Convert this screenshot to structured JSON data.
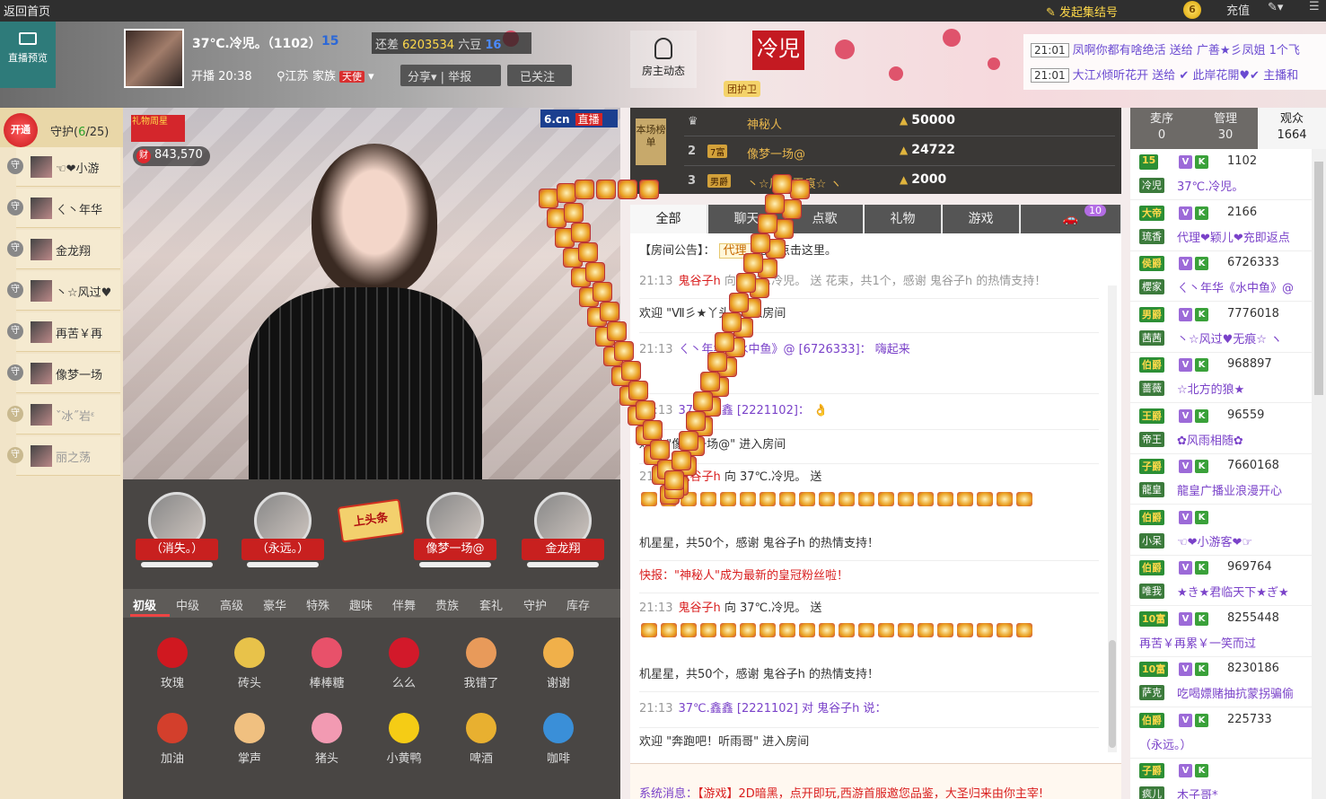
{
  "topbar": {
    "back_label": "返回首页",
    "rally_label": "发起集结号",
    "coin_label": "6",
    "recharge_label": "充值"
  },
  "header": {
    "preview_label": "直播预览",
    "host_name": "37℃.冷児。（1102）",
    "host_level": "15",
    "gap_label": "还差",
    "gap_amount": "6203534",
    "gap_unit": "六豆",
    "next_level": "16",
    "live_time": "开播 20:38",
    "location": "江苏",
    "family_label": "家族",
    "family_tag": "天使",
    "share_label": "分享▾ | 举报",
    "follow_label": "已关注",
    "owner_news_label": "房主动态",
    "room_logo": "冷児",
    "guard_badge": "团护卫",
    "ticker": [
      {
        "time": "21:01",
        "text": "凤啊你都有啥绝活 送给 广善★彡凤姐 1个飞"
      },
      {
        "time": "21:01",
        "text": "大江ﾒ倾听花开 送给 ✔ 此岸花開♥✔ 主播和"
      }
    ]
  },
  "guards": {
    "open_label": "开通",
    "title": "守护(",
    "count": "6",
    "total": "/25)",
    "g_label": "守",
    "items": [
      {
        "name": "☜❤小游"
      },
      {
        "name": "ㄑ丶年华"
      },
      {
        "name": "金龙翔"
      },
      {
        "name": "丶☆风过♥"
      },
      {
        "name": "再苦￥再"
      },
      {
        "name": "像梦一场"
      },
      {
        "name": "ˇ冰˝岩ᵋ"
      },
      {
        "name": "丽之荡"
      }
    ]
  },
  "video": {
    "gift_star": "礼物周星",
    "wealth_label": "财",
    "wealth_value": "843,570",
    "brand": "6.cn",
    "brand_tag": "直播"
  },
  "fans": [
    {
      "name": "（消失。）"
    },
    {
      "name": "（永远。）"
    },
    {
      "name": "像梦一场@"
    },
    {
      "name": "金龙翔"
    }
  ],
  "headline_label": "上头条",
  "gift_tabs": [
    "初级",
    "中级",
    "高级",
    "豪华",
    "特殊",
    "趣味",
    "伴舞",
    "贵族",
    "套礼",
    "守护",
    "库存"
  ],
  "gifts": [
    {
      "name": "玫瑰",
      "color": "#d01820"
    },
    {
      "name": "砖头",
      "color": "#e8c24a"
    },
    {
      "name": "棒棒糖",
      "color": "#e8516a"
    },
    {
      "name": "么么",
      "color": "#d2192a"
    },
    {
      "name": "我错了",
      "color": "#e89a5a"
    },
    {
      "name": "谢谢",
      "color": "#f0b04a"
    },
    {
      "name": "加油",
      "color": "#d33f2c"
    },
    {
      "name": "掌声",
      "color": "#f0c080"
    },
    {
      "name": "猪头",
      "color": "#f29ab2"
    },
    {
      "name": "小黄鸭",
      "color": "#f5cc15"
    },
    {
      "name": "啤酒",
      "color": "#e8b030"
    },
    {
      "name": "咖啡",
      "color": "#3a8fd8"
    }
  ],
  "rank": {
    "tag": "本场榜单",
    "rows": [
      {
        "no": "",
        "badge": "",
        "name": "神秘人",
        "value": "50000"
      },
      {
        "no": "2",
        "badge": "7富",
        "name": "像梦一场@",
        "value": "24722"
      },
      {
        "no": "3",
        "badge": "男爵",
        "name": "丶☆风过无痕☆ ヽ",
        "value": "2000"
      }
    ]
  },
  "chat_tabs": [
    "全部",
    "聊天",
    "点歌",
    "礼物",
    "游戏"
  ],
  "car_count": "10",
  "chat": {
    "notice_prefix": "【房间公告】：",
    "notice_link": "代理",
    "notice_suffix": "充值点击这里。",
    "messages": [
      {
        "time": "21:13",
        "user": "鬼谷子h",
        "text": " 向 37℃.冷児。 送 花束，共1个，感谢 鬼谷子h 的热情支持！"
      },
      {
        "time": "",
        "user": "",
        "text": "欢迎 \"Ⅶ彡★丫头\" 进入房间"
      },
      {
        "time": "21:13",
        "user": "",
        "text": "ㄑ丶年华《水中鱼》@ [6726333]： 嗨起来"
      },
      {
        "time": "21:13",
        "user": "",
        "text": "37℃.鑫鑫 [2221102]： 👌"
      },
      {
        "time": "",
        "user": "",
        "text": "欢迎 \"像梦一场@\" 进入房间"
      },
      {
        "time": "21:13",
        "user": "鬼谷子h",
        "text": " 向 37℃.冷児。 送"
      },
      {
        "time": "",
        "user": "",
        "text": "机星星，共50个，感谢 鬼谷子h 的热情支持！"
      },
      {
        "time": "",
        "user": "",
        "text": "快报：\"神秘人\"成为最新的皇冠粉丝啦！"
      },
      {
        "time": "21:13",
        "user": "鬼谷子h",
        "text": " 向 37℃.冷児。 送"
      },
      {
        "time": "",
        "user": "",
        "text": "机星星，共50个，感谢 鬼谷子h 的热情支持！"
      },
      {
        "time": "21:13",
        "user": "",
        "text": "37℃.鑫鑫 [2221102] 对 鬼谷子h 说："
      },
      {
        "time": "",
        "user": "",
        "text": "欢迎 \"奔跑吧！听雨哥\" 进入房间"
      }
    ],
    "system_label": "系统消息：",
    "system_text": "【游戏】2D暗黑，点开即玩,西游首服邀您品鉴，大圣归来由你主宰!"
  },
  "audience_tabs": [
    {
      "label": "麦序",
      "count": "0"
    },
    {
      "label": "管理",
      "count": "30"
    },
    {
      "label": "观众",
      "count": "1664"
    }
  ],
  "audience": [
    {
      "rank": "15",
      "id": "1102",
      "fam": "冷児",
      "name": "37℃.冷児。"
    },
    {
      "rank": "大帝",
      "id": "2166",
      "fam": "琉香",
      "name": "代理❤颖儿❤充即返点"
    },
    {
      "rank": "侯爵",
      "id": "6726333",
      "fam": "櫻家",
      "name": "ㄑ丶年华《水中鱼》@"
    },
    {
      "rank": "男爵",
      "id": "7776018",
      "fam": "茜茜",
      "name": "丶☆风过♥无痕☆ ヽ"
    },
    {
      "rank": "伯爵",
      "id": "968897",
      "fam": "蔷薇",
      "name": "☆北方的狼★"
    },
    {
      "rank": "王爵",
      "id": "96559",
      "fam": "帝王",
      "name": "✿风雨相随✿"
    },
    {
      "rank": "子爵",
      "id": "7660168",
      "fam": "龍皇",
      "name": "龍皇广播业浪漫开心"
    },
    {
      "rank": "伯爵",
      "id": "",
      "fam": "小呆",
      "name": "☜❤小游客❤☞"
    },
    {
      "rank": "伯爵",
      "id": "969764",
      "fam": "唯我",
      "name": "★き★君临天下★ぎ★"
    },
    {
      "rank": "10富",
      "id": "8255448",
      "fam": "",
      "name": "再苦￥再累￥一笑而过"
    },
    {
      "rank": "10富",
      "id": "8230186",
      "fam": "萨克",
      "name": "吃喝嫖赌抽抗蒙拐骗偷"
    },
    {
      "rank": "伯爵",
      "id": "225733",
      "fam": "",
      "name": "（永远。）"
    },
    {
      "rank": "子爵",
      "id": "",
      "fam": "疯儿",
      "name": "木子哥*"
    }
  ]
}
